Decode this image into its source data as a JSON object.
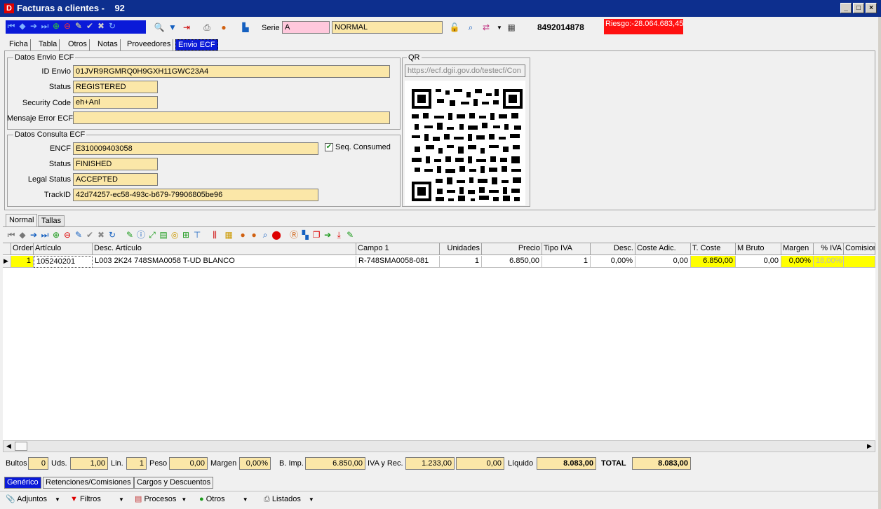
{
  "window": {
    "title": "Facturas a clientes -",
    "number": "92",
    "logo": "D"
  },
  "toolbar": {
    "serie_label": "Serie",
    "serie_value": "A",
    "tipo_value": "NORMAL",
    "phone": "8492014878",
    "riesgo": "Riesgo:-28.064.683,45"
  },
  "tabs_top": [
    "Ficha",
    "Tabla",
    "Otros",
    "Notas",
    "Proveedores",
    "Envio ECF"
  ],
  "envio": {
    "group_title": "Datos Envio ECF",
    "id_label": "ID Envio",
    "id_value": "01JVR9RGMRQ0H9GXH11GWC23A4",
    "status_label": "Status",
    "status_value": "REGISTERED",
    "security_label": "Security Code",
    "security_value": "eh+Anl",
    "error_label": "Mensaje Error ECF",
    "error_value": ""
  },
  "consulta": {
    "group_title": "Datos Consulta ECF",
    "encf_label": "ENCF",
    "encf_value": "E310009403058",
    "seq_label": "Seq. Consumed",
    "status_label": "Status",
    "status_value": "FINISHED",
    "legal_label": "Legal Status",
    "legal_value": "ACCEPTED",
    "track_label": "TrackID",
    "track_value": "42d74257-ec58-493c-b679-79906805be96"
  },
  "qr": {
    "title": "QR",
    "url": "https://ecf.dgii.gov.do/testecf/Con"
  },
  "tabs_mid": [
    "Normal",
    "Tallas"
  ],
  "grid": {
    "headers": [
      "Orden",
      "Artículo",
      "Desc. Artículo",
      "Campo 1",
      "Unidades",
      "Precio",
      "Tipo IVA",
      "Desc.",
      "Coste Adic.",
      "T. Coste",
      "M Bruto",
      "Margen",
      "% IVA",
      "Comision"
    ],
    "row": [
      "1",
      "105240201",
      "L003 2K24 748SMA0058 T-UD BLANCO",
      "R-748SMA0058-081",
      "1",
      "6.850,00",
      "1",
      "0,00%",
      "0,00",
      "6.850,00",
      "0,00",
      "0,00%",
      "18,00%",
      ""
    ]
  },
  "totals": {
    "bultos_label": "Bultos",
    "bultos": "0",
    "uds_label": "Uds.",
    "uds": "1,00",
    "lin_label": "Lin.",
    "lin": "1",
    "peso_label": "Peso",
    "peso": "0,00",
    "margen_label": "Margen",
    "margen": "0,00%",
    "bimp_label": "B. Imp.",
    "bimp": "6.850,00",
    "iva_label": "IVA y Rec.",
    "iva": "1.233,00",
    "rec": "0,00",
    "liquido_label": "Líquido",
    "liquido": "8.083,00",
    "total_label": "TOTAL",
    "total": "8.083,00"
  },
  "tabs_bottom": [
    "Genérico",
    "Retenciones/Comisiones",
    "Cargos y Descuentos"
  ],
  "menu": [
    "Adjuntos",
    "Filtros",
    "Procesos",
    "Otros",
    "Listados"
  ]
}
